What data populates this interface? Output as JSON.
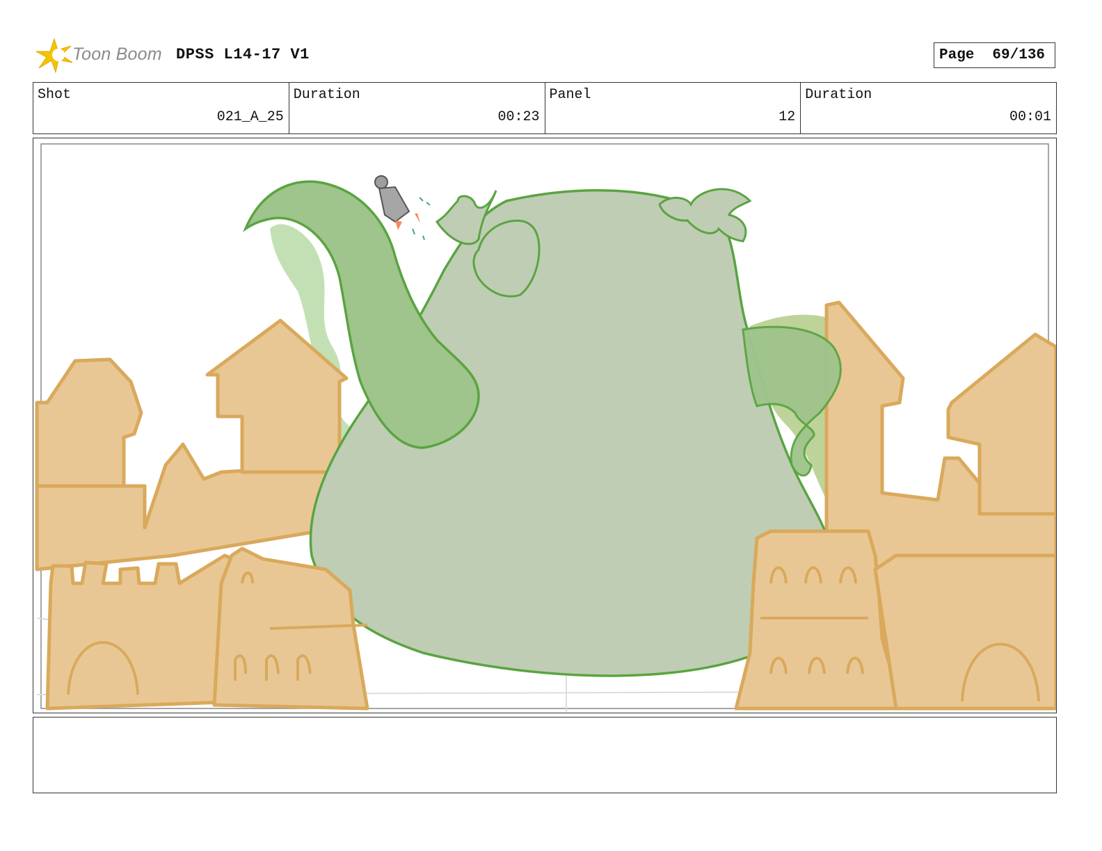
{
  "header": {
    "logo_text": "Toon Boom",
    "title": "DPSS L14-17 V1",
    "page_label": "Page",
    "page_value": "69/136"
  },
  "info": {
    "shot_label": "Shot",
    "shot_value": "021_A_25",
    "duration_label": "Duration",
    "duration_value": "00:23",
    "panel_label": "Panel",
    "panel_value": "12",
    "panel_duration_label": "Duration",
    "panel_duration_value": "00:01"
  },
  "colors": {
    "sand": "#e9c794",
    "sand_line": "#d9a95c",
    "monster_fill": "#bfcdb4",
    "monster_line": "#5aa441",
    "tail_fill": "#9fc48c",
    "smoke": "#b8dba8",
    "logo_star": "#f5c400"
  },
  "notes": ""
}
